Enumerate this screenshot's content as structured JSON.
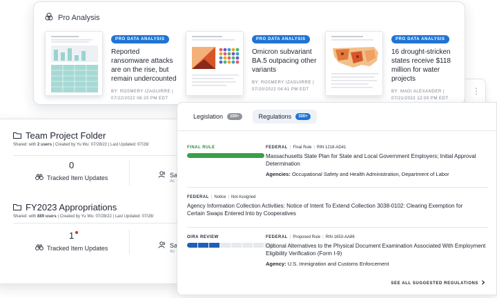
{
  "pro": {
    "header_label": "Pro Analysis",
    "articles": [
      {
        "badge": "PRO DATA ANALYSIS",
        "title": "Reported ransomware attacks are on the rise, but remain undercounted",
        "byline": "BY: ROSMERY IZAGUIRRE |",
        "date": "07/22/2022 06:20 PM EDT"
      },
      {
        "badge": "PRO DATA ANALYSIS",
        "title": "Omicron subvariant BA.5 outpacing other variants",
        "byline": "BY: ROSMERY IZAGUIRRE |",
        "date": "07/20/2022 04:41 PM EDT"
      },
      {
        "badge": "PRO DATA ANALYSIS",
        "title": "16 drought-stricken states receive $118 million for water projects",
        "byline": "BY: MADI ALEXANDER |",
        "date": "07/21/2022 12:00 PM EDT"
      }
    ]
  },
  "folders": [
    {
      "title": "Team Project Folder",
      "meta_shared": "Shared: with",
      "meta_users": "2 users",
      "meta_created": "Created by Yu Wu: 07/28/22",
      "meta_updated": "Last Updated: 07/28/",
      "stat_value": "0",
      "stat_label": "Tracked Item Updates",
      "side_label": "Sav",
      "side_sub": "Ac"
    },
    {
      "title": "FY2023 Appropriations",
      "meta_shared": "Shared: with",
      "meta_users": "889 users",
      "meta_created": "Created by Yu Wu: 07/28/22",
      "meta_updated": "Last Updated: 07/28/",
      "stat_value": "1",
      "stat_label": "Tracked Item Updates",
      "side_label": "Sav",
      "side_sub": "Ac"
    }
  ],
  "regs": {
    "tabs": [
      {
        "label": "Legislation",
        "count": "100+"
      },
      {
        "label": "Regulations",
        "count": "100+"
      }
    ],
    "rows": [
      {
        "status": "FINAL RULE",
        "level": "FEDERAL",
        "type": "Final Rule",
        "rin": "RIN 1218-AD41",
        "title": "Massachusetts State Plan for State and Local Government Employers; Initial Approval Determination",
        "agency_label": "Agencies:",
        "agency": "Occupational Safety and Health Administration, Department of Labor"
      },
      {
        "level": "FEDERAL",
        "type": "Notice",
        "rin": "Not Assigned",
        "title": "Agency Information Collection Activities: Notice of Intent To Extend Collection 3038-0102: Clearing Exemption for Certain Swaps Entered Into by Cooperatives"
      },
      {
        "status": "OIRA REVIEW",
        "progress_fraction": 0.375,
        "level": "FEDERAL",
        "type": "Proposed Rule",
        "rin": "RIN 1653-AA86",
        "title": "Optional Alternatives to the Physical Document Examination Associated With Employment Eligibility Verification (Form I-9)",
        "agency_label": "Agency:",
        "agency": "U.S. Immigration and Customs Enforcement"
      }
    ],
    "see_all": "SEE ALL SUGGESTED REGULATIONS"
  },
  "colors": {
    "accent": "#1f74d4",
    "final_rule_green": "#3aa048",
    "progress_blue": "#1f5fb8",
    "notification_dot": "#d8282a"
  }
}
